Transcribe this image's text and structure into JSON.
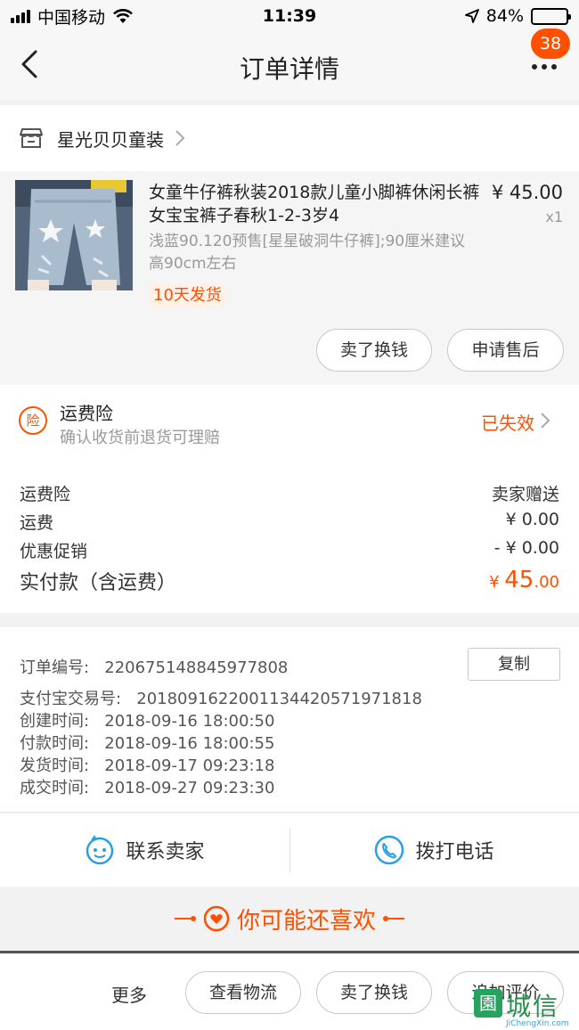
{
  "status_bar": {
    "carrier": "中国移动",
    "time": "11:39",
    "battery": "84%",
    "battery_level": 0.84,
    "icons": [
      "signal-icon",
      "wifi-icon",
      "location-arrow-icon",
      "battery-icon"
    ]
  },
  "nav": {
    "title": "订单详情",
    "badge": "38",
    "icons": [
      "back-arrow-icon",
      "more-dots-icon"
    ]
  },
  "shop": {
    "name": "星光贝贝童装",
    "icons": [
      "store-icon",
      "chevron-right-icon"
    ]
  },
  "product": {
    "title": "女童牛仔裤秋装2018款儿童小脚裤休闲长裤女宝宝裤子春秋1-2-3岁4",
    "sku": "浅蓝90.120预售[星星破洞牛仔裤];90厘米建议高90cm左右",
    "tag": "10天发货",
    "price": "¥ 45.00",
    "qty": "x1",
    "image_icon": "jeans-product-image"
  },
  "item_actions": {
    "sell_label": "卖了换钱",
    "aftersale_label": "申请售后"
  },
  "insurance": {
    "icon_text": "险",
    "title": "运费险",
    "subtitle": "确认收货前退货可理赔",
    "status": "已失效"
  },
  "fees": {
    "rows": [
      {
        "label": "运费险",
        "value": "卖家赠送"
      },
      {
        "label": "运费",
        "value": "¥ 0.00"
      },
      {
        "label": "优惠促销",
        "value": "- ¥ 0.00"
      }
    ],
    "total_label": "实付款（含运费）",
    "total_currency": "¥ ",
    "total_int": "45",
    "total_dec": ".00"
  },
  "order_info": {
    "order_no_label": "订单编号:",
    "order_no": "220675148845977808",
    "copy_label": "复制",
    "alipay_label": "支付宝交易号:",
    "alipay_no": "2018091622001134420571971818",
    "created_label": "创建时间:",
    "created": "2018-09-16 18:00:50",
    "paid_label": "付款时间:",
    "paid": "2018-09-16 18:00:55",
    "shipped_label": "发货时间:",
    "shipped": "2018-09-17 09:23:18",
    "closed_label": "成交时间:",
    "closed": "2018-09-27 09:23:30"
  },
  "contact": {
    "seller_label": "联系卖家",
    "phone_label": "拨打电话"
  },
  "recommend": {
    "title": "你可能还喜欢"
  },
  "bottom_bar": {
    "more_label": "更多",
    "logistics_label": "查看物流",
    "sell_label": "卖了换钱",
    "review_label": "追加评价"
  },
  "watermark": {
    "box": "園",
    "text": "城信",
    "url": "JiChengXin.com"
  },
  "colors": {
    "accent": "#ff5000",
    "blue_icon": "#2a9fe8",
    "background": "#f2f2f2"
  }
}
